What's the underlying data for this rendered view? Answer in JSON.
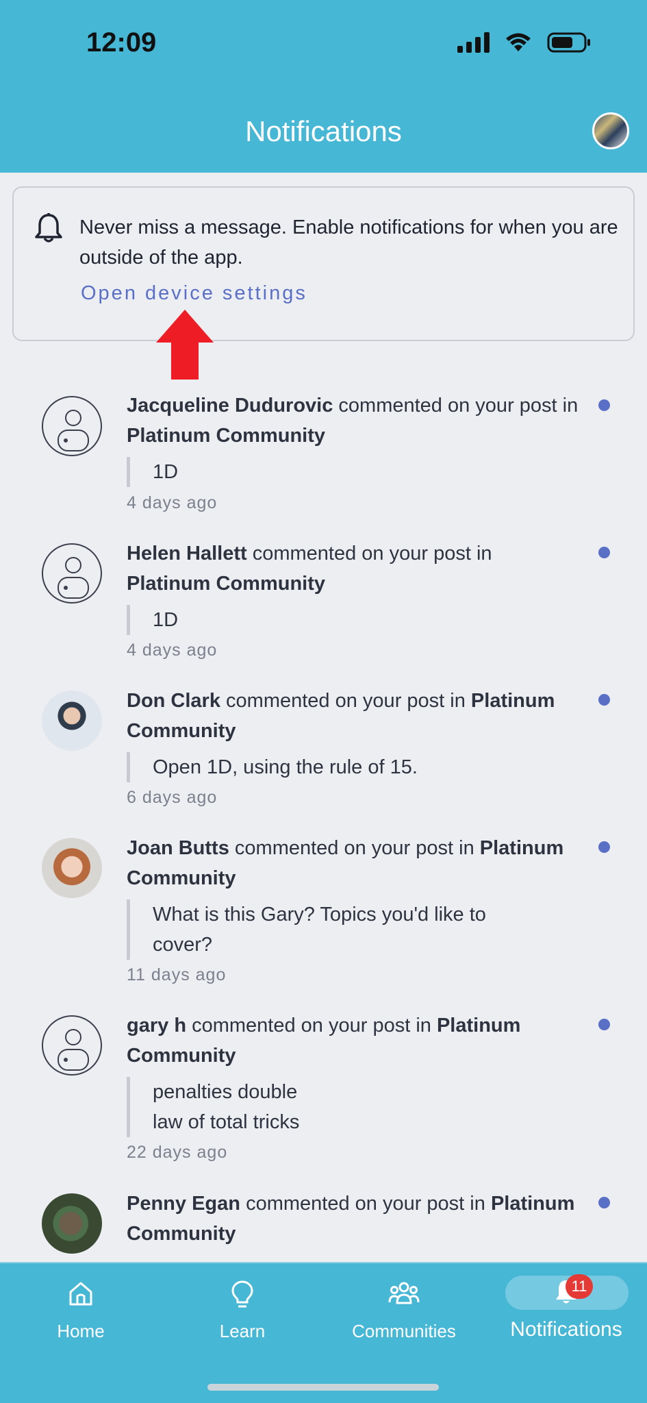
{
  "status_bar": {
    "time": "12:09"
  },
  "header": {
    "title": "Notifications"
  },
  "banner": {
    "message": "Never miss a message. Enable notifications for when you are outside of the app.",
    "link_label": "Open device settings"
  },
  "notifications": [
    {
      "name": "Jacqueline Dudurovic",
      "action": "commented on your post in",
      "community": "Platinum Community",
      "quote": [
        "1D"
      ],
      "time": "4 days ago",
      "avatar": "placeholder",
      "unread": true
    },
    {
      "name": "Helen Hallett",
      "action": "commented on your post in",
      "community": "Platinum Community",
      "quote": [
        "1D"
      ],
      "time": "4 days ago",
      "avatar": "placeholder",
      "unread": true
    },
    {
      "name": "Don Clark",
      "action": "commented on your post in",
      "community": "Platinum Community",
      "quote": [
        "Open 1D, using the rule of 15."
      ],
      "time": "6 days ago",
      "avatar": "photo",
      "unread": true
    },
    {
      "name": "Joan Butts",
      "action": "commented on your post in",
      "community": "Platinum Community",
      "quote": [
        "What is this Gary? Topics you'd like to",
        "cover?"
      ],
      "time": "11 days ago",
      "avatar": "photo",
      "unread": true
    },
    {
      "name": "gary h",
      "action": "commented on your post in",
      "community": "Platinum Community",
      "quote": [
        "penalties double",
        "law of total tricks"
      ],
      "time": "22 days ago",
      "avatar": "placeholder",
      "unread": true
    },
    {
      "name": "Penny Egan",
      "action": "commented on your post in",
      "community": "Platinum Community",
      "quote": [],
      "time": "",
      "avatar": "photo",
      "unread": true
    }
  ],
  "bottom_nav": {
    "items": [
      {
        "label": "Home",
        "icon": "home-icon"
      },
      {
        "label": "Learn",
        "icon": "lightbulb-icon"
      },
      {
        "label": "Communities",
        "icon": "people-icon"
      },
      {
        "label": "Notifications",
        "icon": "bell-icon"
      }
    ],
    "badge_count": "11"
  },
  "colors": {
    "header": "#47b7d6",
    "link": "#5a6fc6",
    "unread_dot": "#5a6fc6",
    "badge": "#e53935",
    "arrow": "#ee1c25"
  }
}
